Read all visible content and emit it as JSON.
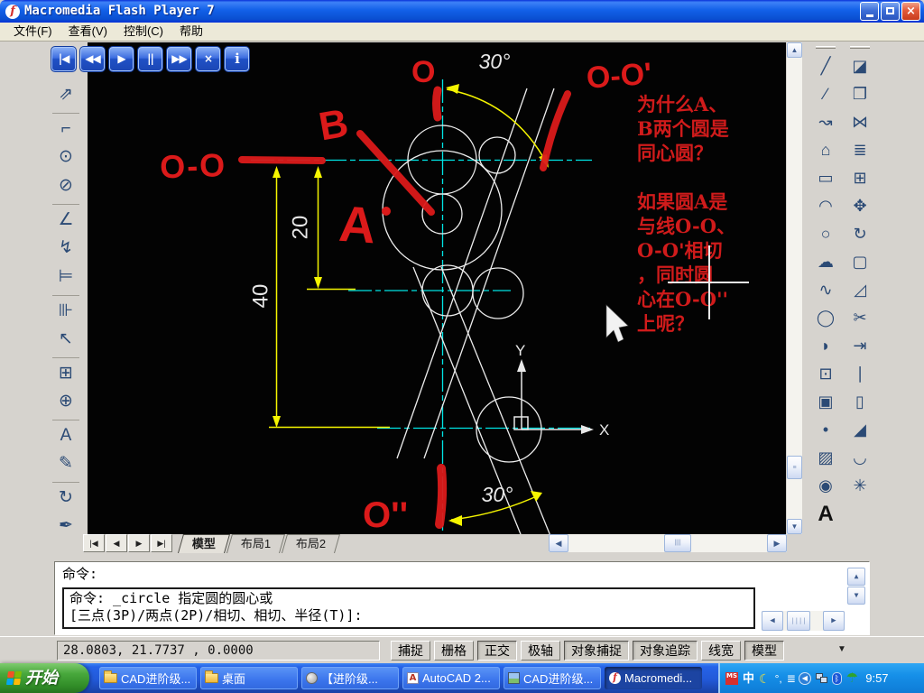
{
  "window": {
    "title": "Macromedia Flash Player 7",
    "icon_glyph": "f",
    "controls": [
      {
        "name": "minimize-button"
      },
      {
        "name": "restore-button"
      },
      {
        "name": "close-button",
        "glyph": "×"
      }
    ]
  },
  "menu": [
    "文件(F)",
    "查看(V)",
    "控制(C)",
    "帮助"
  ],
  "player": {
    "buttons": [
      {
        "name": "goto-start-button",
        "glyph": "|◀"
      },
      {
        "name": "rewind-button",
        "glyph": "◀◀"
      },
      {
        "name": "play-button",
        "glyph": "▶"
      },
      {
        "name": "pause-button",
        "glyph": "||"
      },
      {
        "name": "forward-button",
        "glyph": "▶▶"
      },
      {
        "name": "stop-button",
        "glyph": "×"
      },
      {
        "name": "info-button",
        "glyph": "i"
      }
    ]
  },
  "cad": {
    "dim_toolbar": [
      {
        "name": "linear-dimension-icon",
        "glyph": "↔",
        "sep": false
      },
      {
        "name": "aligned-dimension-icon",
        "glyph": "⇗",
        "sep": false
      },
      {
        "name": "ordinate-dimension-icon",
        "glyph": "⌐",
        "sep": true
      },
      {
        "name": "radius-dimension-icon",
        "glyph": "⊙",
        "sep": false
      },
      {
        "name": "diameter-dimension-icon",
        "glyph": "⊘",
        "sep": false
      },
      {
        "name": "angular-dimension-icon",
        "glyph": "∠",
        "sep": true
      },
      {
        "name": "quick-dimension-icon",
        "glyph": "↯",
        "sep": false
      },
      {
        "name": "baseline-dimension-icon",
        "glyph": "⊨",
        "sep": false
      },
      {
        "name": "continue-dimension-icon",
        "glyph": "⊪",
        "sep": true
      },
      {
        "name": "quick-leader-icon",
        "glyph": "↖",
        "sep": false
      },
      {
        "name": "tolerance-icon",
        "glyph": "⊞",
        "sep": true
      },
      {
        "name": "center-mark-icon",
        "glyph": "⊕",
        "sep": false
      },
      {
        "name": "dimension-edit-icon",
        "glyph": "A",
        "sep": true
      },
      {
        "name": "dimension-text-edit-icon",
        "glyph": "✎",
        "sep": false
      },
      {
        "name": "dimension-update-icon",
        "glyph": "↻",
        "sep": true
      },
      {
        "name": "dimension-style-icon",
        "glyph": "✒",
        "sep": false
      }
    ],
    "draw_toolbar": [
      {
        "name": "line-icon",
        "glyph": "╱"
      },
      {
        "name": "construction-line-icon",
        "glyph": "∕"
      },
      {
        "name": "polyline-icon",
        "glyph": "↝"
      },
      {
        "name": "polygon-icon",
        "glyph": "⌂"
      },
      {
        "name": "rectangle-icon",
        "glyph": "▭"
      },
      {
        "name": "arc-icon",
        "glyph": "◠"
      },
      {
        "name": "circle-icon",
        "glyph": "○"
      },
      {
        "name": "revision-cloud-icon",
        "glyph": "☁"
      },
      {
        "name": "spline-icon",
        "glyph": "∿"
      },
      {
        "name": "ellipse-icon",
        "glyph": "◯"
      },
      {
        "name": "ellipse-arc-icon",
        "glyph": "◗"
      },
      {
        "name": "insert-block-icon",
        "glyph": "⊡"
      },
      {
        "name": "make-block-icon",
        "glyph": "▣"
      },
      {
        "name": "point-icon",
        "glyph": "•"
      },
      {
        "name": "hatch-icon",
        "glyph": "▨"
      },
      {
        "name": "region-icon",
        "glyph": "◉"
      },
      {
        "name": "multiline-text-icon",
        "glyph": "A"
      }
    ],
    "modify_toolbar": [
      {
        "name": "erase-icon",
        "glyph": "◪"
      },
      {
        "name": "copy-icon",
        "glyph": "❐"
      },
      {
        "name": "mirror-icon",
        "glyph": "⋈"
      },
      {
        "name": "offset-icon",
        "glyph": "≣"
      },
      {
        "name": "array-icon",
        "glyph": "⊞"
      },
      {
        "name": "move-icon",
        "glyph": "✥"
      },
      {
        "name": "rotate-icon",
        "glyph": "↻"
      },
      {
        "name": "stretch-icon",
        "glyph": "▢"
      },
      {
        "name": "scale-icon",
        "glyph": "◿"
      },
      {
        "name": "trim-icon",
        "glyph": "✂"
      },
      {
        "name": "extend-icon",
        "glyph": "⇥"
      },
      {
        "name": "break-at-point-icon",
        "glyph": "∣"
      },
      {
        "name": "break-icon",
        "glyph": "▯"
      },
      {
        "name": "chamfer-icon",
        "glyph": "◢"
      },
      {
        "name": "fillet-icon",
        "glyph": "◡"
      },
      {
        "name": "explode-icon",
        "glyph": "✳"
      }
    ],
    "tabs": {
      "nav": [
        {
          "name": "tab-first-button",
          "glyph": "|◀"
        },
        {
          "name": "tab-prev-button",
          "glyph": "◀"
        },
        {
          "name": "tab-next-button",
          "glyph": "▶"
        },
        {
          "name": "tab-last-button",
          "glyph": "▶|"
        }
      ],
      "items": [
        {
          "label": "模型",
          "active": true
        },
        {
          "label": "布局1",
          "active": false
        },
        {
          "label": "布局2",
          "active": false
        }
      ]
    },
    "command": {
      "history": "命令:",
      "prompt1": "命令: _circle 指定圆的圆心或",
      "prompt2": "[三点(3P)/两点(2P)/相切、相切、半径(T)]:"
    },
    "status": {
      "coords": "28.0803,  21.7737 , 0.0000",
      "buttons": [
        {
          "label": "捕捉",
          "pressed": false
        },
        {
          "label": "栅格",
          "pressed": false
        },
        {
          "label": "正交",
          "pressed": true
        },
        {
          "label": "极轴",
          "pressed": false
        },
        {
          "label": "对象捕捉",
          "pressed": true
        },
        {
          "label": "对象追踪",
          "pressed": true
        },
        {
          "label": "线宽",
          "pressed": false
        },
        {
          "label": "模型",
          "pressed": true
        }
      ]
    }
  },
  "drawing": {
    "dim_40": "40",
    "dim_20": "20",
    "angle_top": "30°",
    "angle_bottom": "30°",
    "axis_x": "X",
    "axis_y": "Y",
    "label_oo": "O-O",
    "label_b": "B",
    "label_a": "A",
    "label_o": "O",
    "label_oo_prime": "O-O'",
    "label_o_doubleprime": "O''",
    "question": "为什么A、\nB两个圆是\n同心圆？\n\n如果圆A是\n与线O-O、\nO-O'相切\n，同时圆\n心在O-O''\n上呢？"
  },
  "taskbar": {
    "start_label": "开始",
    "tasks": [
      {
        "name": "task-cad-folder",
        "label": "CAD进阶级...",
        "icon": "folder-icon",
        "active": false
      },
      {
        "name": "task-desktop-folder",
        "label": "桌面",
        "icon": "folder-icon",
        "active": false
      },
      {
        "name": "task-media-player",
        "label": "【进阶级...",
        "icon": "media-player-icon",
        "active": false
      },
      {
        "name": "task-autocad",
        "label": "AutoCAD 2...",
        "icon": "autocad-icon",
        "active": false
      },
      {
        "name": "task-image-viewer",
        "label": "CAD进阶级...",
        "icon": "image-icon",
        "active": false
      },
      {
        "name": "task-flash-player",
        "label": "Macromedi...",
        "icon": "flash-icon",
        "active": true
      }
    ],
    "tray": {
      "icons": [
        {
          "name": "ime-ms-pinyin-icon",
          "cls": "ms",
          "glyph": "MS"
        },
        {
          "name": "ime-chinese-icon",
          "cls": "zh",
          "glyph": "中"
        },
        {
          "name": "moon-icon",
          "cls": "moon",
          "glyph": "☾"
        },
        {
          "name": "ime-punct-icon",
          "cls": "",
          "glyph": "°,"
        },
        {
          "name": "ime-bars-icon",
          "cls": "bars",
          "glyph": "≣"
        },
        {
          "name": "hide-icons-button",
          "cls": "hide",
          "glyph": "◀"
        },
        {
          "name": "network-icon",
          "cls": "net",
          "glyph": ""
        },
        {
          "name": "bluetooth-icon",
          "cls": "bt",
          "glyph": "ᛒ"
        },
        {
          "name": "safety-umbrella-icon",
          "cls": "umb",
          "glyph": "☂"
        }
      ],
      "time": "9:57"
    }
  }
}
